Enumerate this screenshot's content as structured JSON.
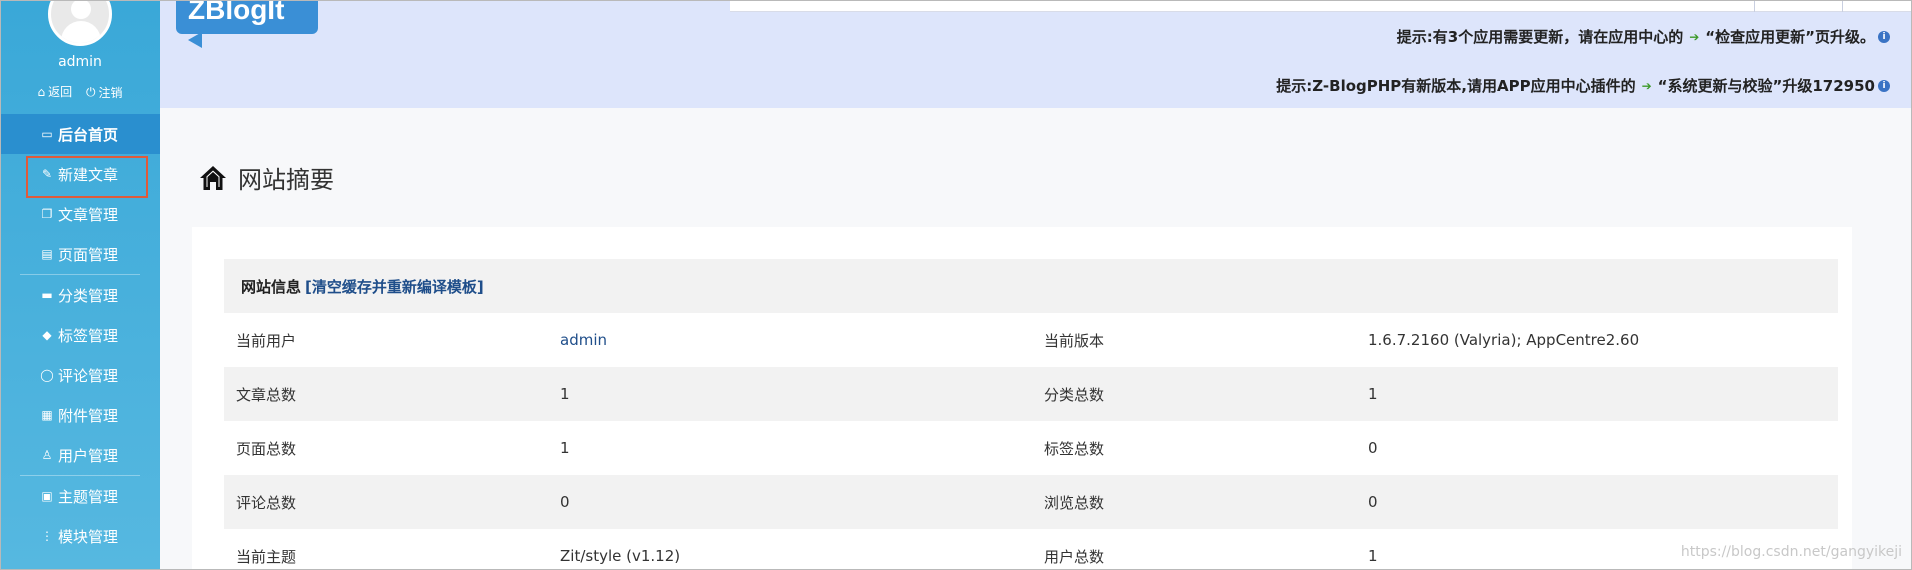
{
  "sidebar": {
    "username": "admin",
    "links": [
      {
        "icon": "home-icon",
        "label": "返回"
      },
      {
        "icon": "power-icon",
        "label": "注销"
      }
    ],
    "menu": [
      {
        "label": "后台首页",
        "icon": "window-icon"
      },
      {
        "label": "新建文章",
        "icon": "edit-icon"
      },
      {
        "label": "文章管理",
        "icon": "document-icon"
      },
      {
        "label": "页面管理",
        "icon": "page-icon"
      },
      {
        "label": "分类管理",
        "icon": "folder-icon"
      },
      {
        "label": "标签管理",
        "icon": "tag-icon"
      },
      {
        "label": "评论管理",
        "icon": "comment-icon"
      },
      {
        "label": "附件管理",
        "icon": "attachment-icon"
      },
      {
        "label": "用户管理",
        "icon": "user-icon"
      },
      {
        "label": "主题管理",
        "icon": "theme-icon"
      },
      {
        "label": "模块管理",
        "icon": "module-icon"
      }
    ]
  },
  "header": {
    "logo": "ZBlogIt",
    "notices": [
      {
        "prefix": "提示:有3个应用需要更新，请在应用中心的",
        "link": "“检查应用更新”",
        "suffix": "页升级。"
      },
      {
        "prefix": "提示:Z-BlogPHP有新版本,请用APP应用中心插件的",
        "link": "“系统更新与校验”",
        "suffix": "升级172950"
      }
    ]
  },
  "main": {
    "title": "网站摘要",
    "table": {
      "head_label": "网站信息",
      "head_link": "[清空缓存并重新编译模板]",
      "rows": [
        [
          "当前用户",
          "admin",
          "当前版本",
          "1.6.7.2160 (Valyria); AppCentre2.60"
        ],
        [
          "文章总数",
          "1",
          "分类总数",
          "1"
        ],
        [
          "页面总数",
          "1",
          "标签总数",
          "0"
        ],
        [
          "评论总数",
          "0",
          "浏览总数",
          "0"
        ],
        [
          "当前主题",
          "Zit/style (v1.12)",
          "用户总数",
          "1"
        ]
      ]
    }
  },
  "watermark": "https://blog.csdn.net/gangyikeji",
  "colors": {
    "sidebar": "#3aa8d8",
    "active": "#2a8fcf",
    "header_bg": "#dde5fb",
    "link": "#1f4e8a",
    "highlight_box": "#e05a3a"
  }
}
